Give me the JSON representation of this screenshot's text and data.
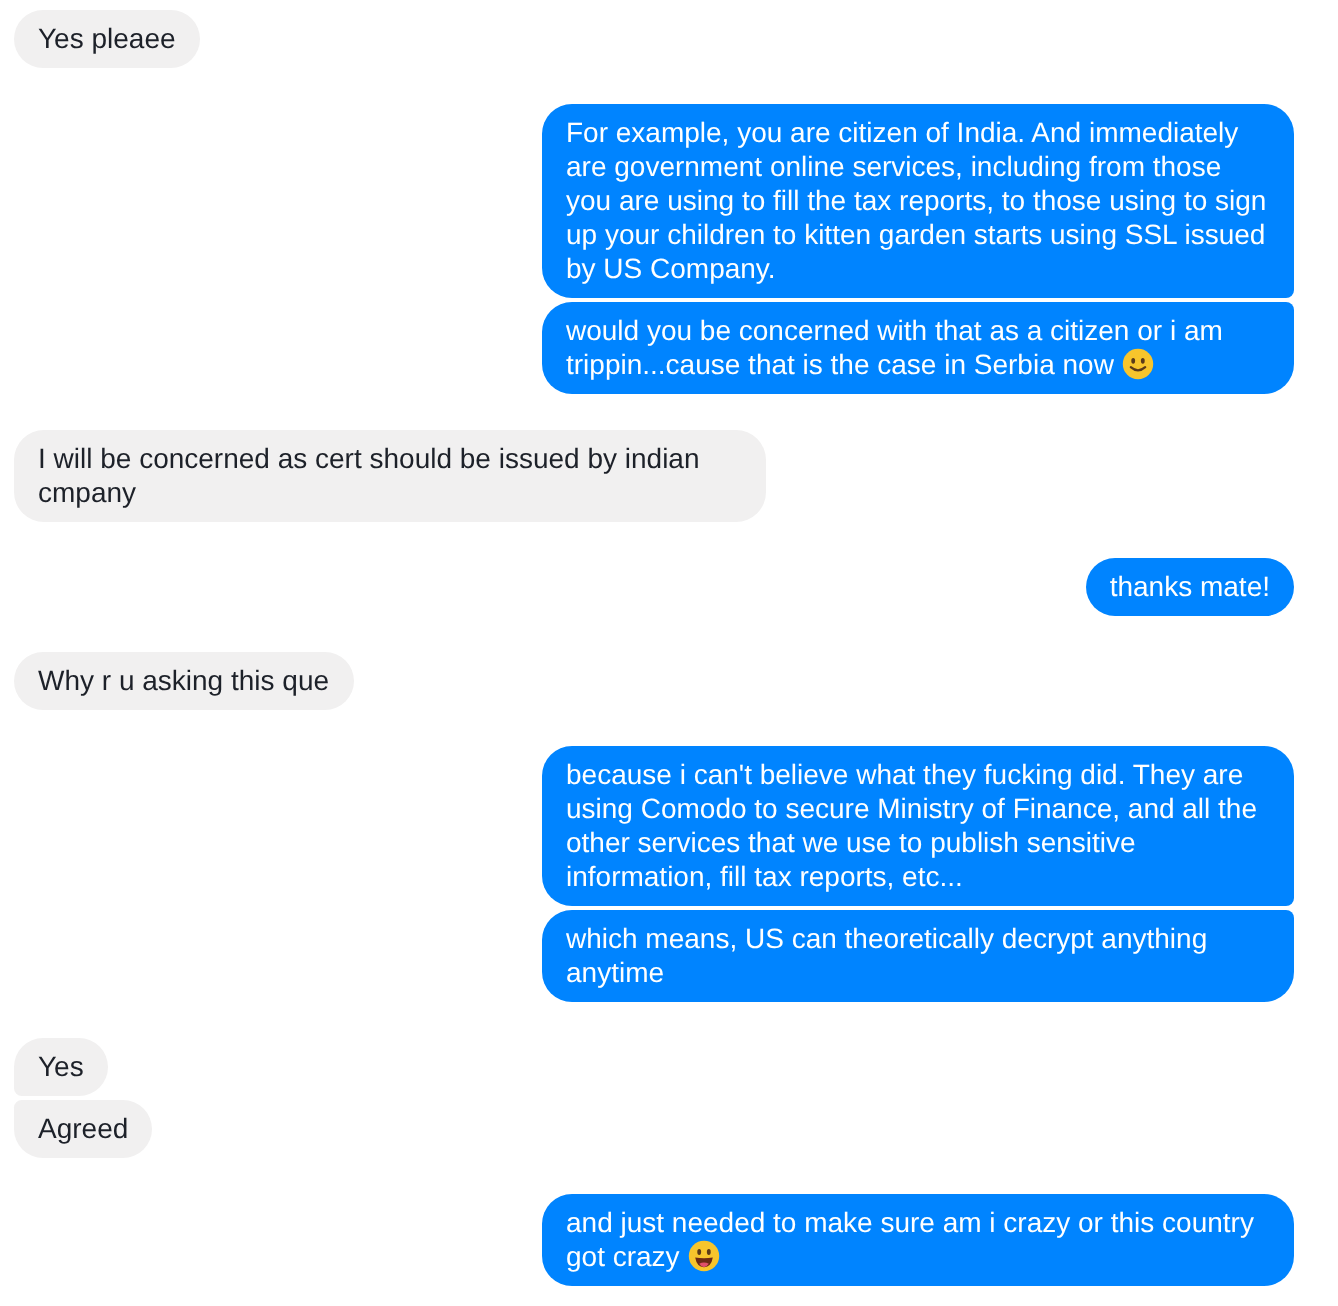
{
  "groups": [
    {
      "outgoing": false,
      "messages": [
        {
          "kind": "plain",
          "text": "Yes pleaee"
        }
      ]
    },
    {
      "outgoing": true,
      "messages": [
        {
          "kind": "plain",
          "text": "For example, you are citizen of India. And immediately are government online services, including from those you are using to fill the tax reports, to those using to sign up your children to kitten garden starts using SSL issued by US Company."
        },
        {
          "kind": "smiley",
          "text": "would you be concerned with that as a citizen or i am trippin...cause that is the case in Serbia now"
        }
      ]
    },
    {
      "outgoing": false,
      "messages": [
        {
          "kind": "plain",
          "text": "I will be concerned as cert should be issued by indian cmpany"
        }
      ]
    },
    {
      "outgoing": true,
      "messages": [
        {
          "kind": "plain",
          "text": "thanks mate!"
        }
      ]
    },
    {
      "outgoing": false,
      "messages": [
        {
          "kind": "plain",
          "text": "Why r u asking this que"
        }
      ]
    },
    {
      "outgoing": true,
      "messages": [
        {
          "kind": "plain",
          "text": "because i can't believe what they fucking did. They are using Comodo to secure Ministry of Finance, and all the other services that we use to publish sensitive information, fill tax reports, etc..."
        },
        {
          "kind": "plain",
          "text": "which means, US can theoretically decrypt anything anytime"
        }
      ]
    },
    {
      "outgoing": false,
      "messages": [
        {
          "kind": "plain",
          "text": "Yes"
        },
        {
          "kind": "plain",
          "text": "Agreed"
        }
      ]
    },
    {
      "outgoing": true,
      "messages": [
        {
          "kind": "grinning",
          "text": "and just needed to make sure am i crazy or this country got crazy"
        }
      ]
    }
  ]
}
